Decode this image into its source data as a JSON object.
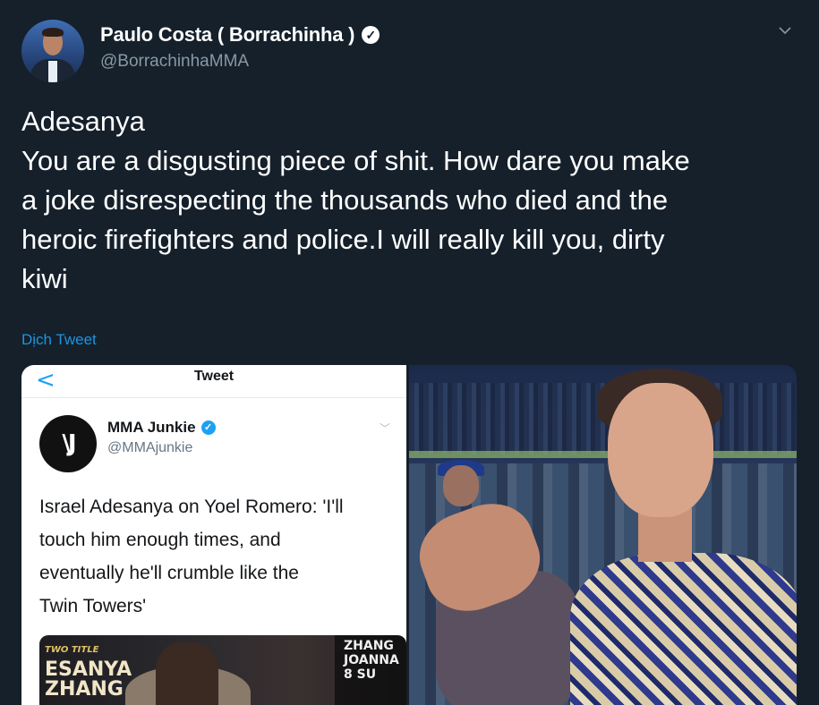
{
  "author": {
    "name": "Paulo Costa ( Borrachinha )",
    "handle": "@BorrachinhaMMA",
    "verified_mark": "✓"
  },
  "tweet": {
    "lines": [
      "Adesanya",
      "You are a disgusting piece of shit. How dare you make",
      "a joke disrespecting the thousands who died and the",
      "heroic firefighters and police.I will really kill you, dirty",
      "kiwi"
    ],
    "translate_label": "Dịch Tweet"
  },
  "embedded": {
    "back": "<",
    "title": "Tweet",
    "logo": "\\J",
    "name": "MMA Junkie",
    "verified_mark": "✓",
    "handle": "@MMAjunkie",
    "chevron": "﹀",
    "lines": [
      "Israel Adesanya on Yoel Romero: 'I'll",
      "touch him enough times, and",
      "eventually he'll crumble like the",
      "Twin Towers'"
    ],
    "poster_left_small": "TWO TITLE",
    "poster_left_line1": "ESANYA",
    "poster_left_line2": "ZHANG",
    "poster_right_line1": "ZHANG",
    "poster_right_line2": "JOANNA",
    "poster_right_line3": "8 SU"
  },
  "icons": {
    "chevron": "chevron-down-icon",
    "verified": "verified-badge-icon"
  },
  "colors": {
    "background": "#15202b",
    "link": "#1b95e0",
    "secondary_text": "#8899a6"
  }
}
